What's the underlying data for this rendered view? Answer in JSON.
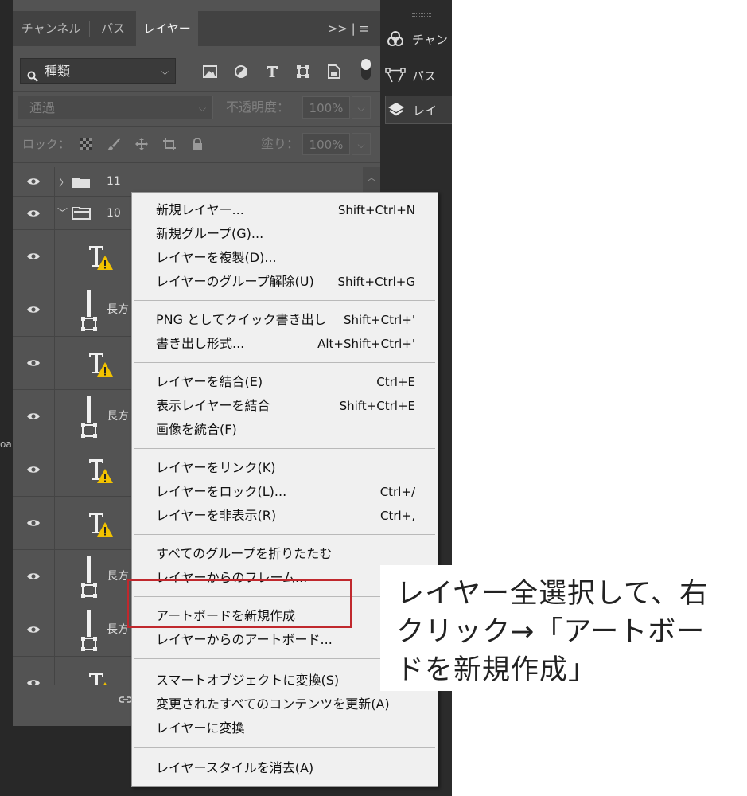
{
  "panel": {
    "tabs": [
      "チャンネル",
      "パス",
      "レイヤー"
    ],
    "active_tab": 2,
    "tab_tools": ">> | ≡"
  },
  "filter": {
    "label": "種類",
    "icons": [
      "image-filter-icon",
      "adjustment-filter-icon",
      "type-filter-icon",
      "shape-filter-icon",
      "smart-object-filter-icon"
    ]
  },
  "blend": {
    "mode": "通過",
    "opacity_label": "不透明度：",
    "opacity_value": "100%"
  },
  "lock": {
    "label": "ロック：",
    "fill_label": "塗り：",
    "fill_value": "100%"
  },
  "layers": [
    {
      "kind": "group-collapsed",
      "name": "11"
    },
    {
      "kind": "group-expanded",
      "name": "10"
    },
    {
      "kind": "text",
      "name": ""
    },
    {
      "kind": "shape",
      "name": "長方"
    },
    {
      "kind": "text",
      "name": ""
    },
    {
      "kind": "shape",
      "name": "長方"
    },
    {
      "kind": "text",
      "name": ""
    },
    {
      "kind": "text",
      "name": ""
    },
    {
      "kind": "shape",
      "name": "長方"
    },
    {
      "kind": "shape",
      "name": "長方"
    },
    {
      "kind": "text",
      "name": ""
    }
  ],
  "dock": {
    "items": [
      "チャン",
      "パス",
      "レイ"
    ]
  },
  "left_strip_text": "oa",
  "context_menu": {
    "groups": [
      [
        {
          "label": "新規レイヤー...",
          "shortcut": "Shift+Ctrl+N"
        },
        {
          "label": "新規グループ(G)...",
          "shortcut": ""
        },
        {
          "label": "レイヤーを複製(D)...",
          "shortcut": ""
        },
        {
          "label": "レイヤーのグループ解除(U)",
          "shortcut": "Shift+Ctrl+G"
        }
      ],
      [
        {
          "label": "PNG としてクイック書き出し",
          "shortcut": "Shift+Ctrl+'"
        },
        {
          "label": "書き出し形式...",
          "shortcut": "Alt+Shift+Ctrl+'"
        }
      ],
      [
        {
          "label": "レイヤーを結合(E)",
          "shortcut": "Ctrl+E"
        },
        {
          "label": "表示レイヤーを結合",
          "shortcut": "Shift+Ctrl+E"
        },
        {
          "label": "画像を統合(F)",
          "shortcut": ""
        }
      ],
      [
        {
          "label": "レイヤーをリンク(K)",
          "shortcut": ""
        },
        {
          "label": "レイヤーをロック(L)...",
          "shortcut": "Ctrl+/"
        },
        {
          "label": "レイヤーを非表示(R)",
          "shortcut": "Ctrl+,"
        }
      ],
      [
        {
          "label": "すべてのグループを折りたたむ",
          "shortcut": ""
        },
        {
          "label": "レイヤーからのフレーム...",
          "shortcut": ""
        }
      ],
      [
        {
          "label": "アートボードを新規作成",
          "shortcut": ""
        },
        {
          "label": "レイヤーからのアートボード...",
          "shortcut": ""
        }
      ],
      [
        {
          "label": "スマートオブジェクトに変換(S)",
          "shortcut": ""
        },
        {
          "label": "変更されたすべてのコンテンツを更新(A)",
          "shortcut": ""
        },
        {
          "label": "レイヤーに変換",
          "shortcut": ""
        }
      ],
      [
        {
          "label": "レイヤースタイルを消去(A)",
          "shortcut": ""
        }
      ]
    ]
  },
  "annotation": {
    "lines": [
      "レイヤー全選択して、右",
      "クリック→「アートボー",
      "ドを新規作成」"
    ],
    "highlight_color": "#c0282d"
  }
}
